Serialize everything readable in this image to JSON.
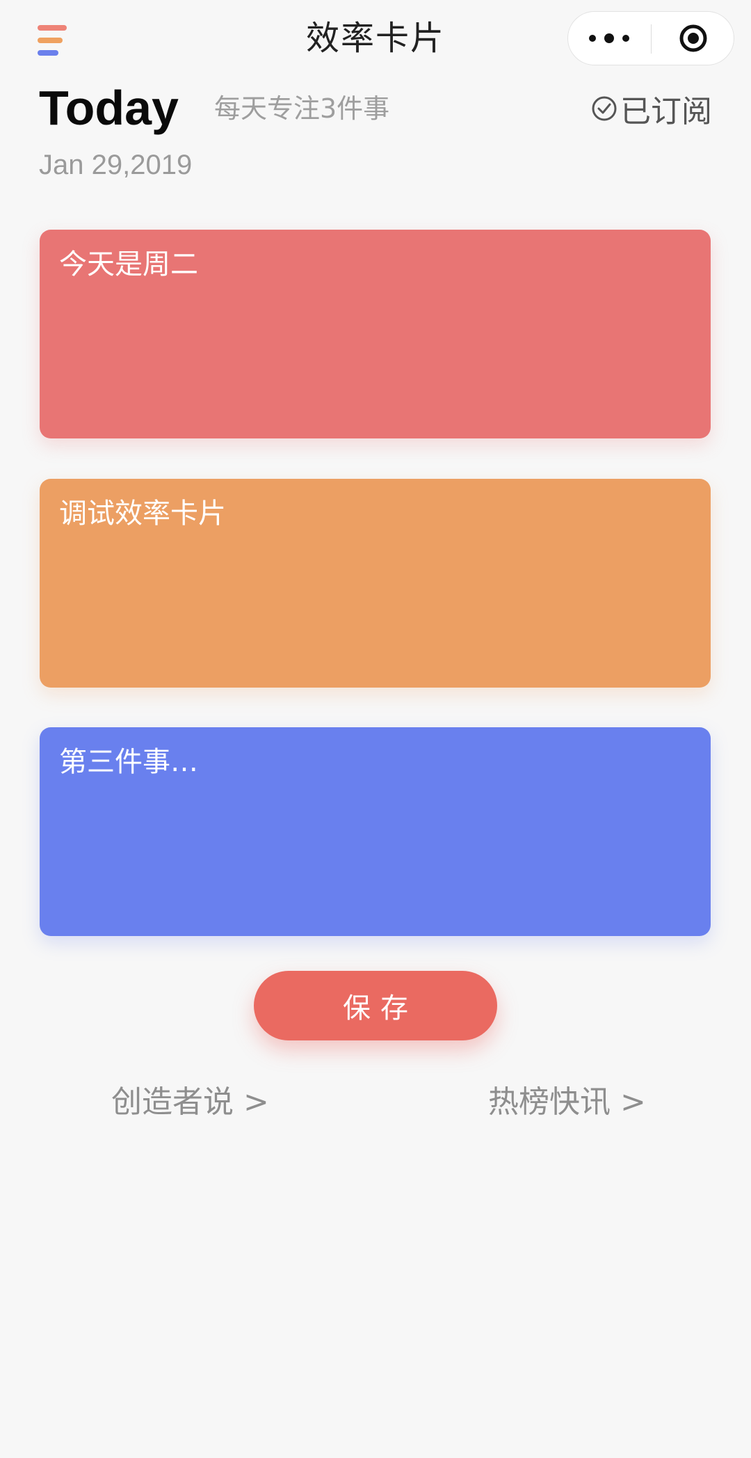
{
  "nav": {
    "title": "效率卡片",
    "menu_icon": "hamburger-menu-icon",
    "more_icon": "more-dots-icon",
    "close_icon": "target-circle-icon",
    "menu_colors": [
      "#ee8377",
      "#efa160",
      "#6b80ec"
    ]
  },
  "header": {
    "today": "Today",
    "slogan": "每天专注3件事",
    "subscribe_label": "已订阅",
    "subscribe_icon": "check-circle-icon",
    "date": "Jan 29,2019"
  },
  "cards": [
    {
      "value": "今天是周二",
      "placeholder": "",
      "color": "#e87574"
    },
    {
      "value": "调试效率卡片",
      "placeholder": "",
      "color": "#ec9f63"
    },
    {
      "value": "",
      "placeholder": "第三件事…",
      "color": "#6980ee"
    }
  ],
  "save_button": {
    "label": "保存",
    "color": "#ea6a61"
  },
  "links": {
    "creator": "创造者说 >",
    "hot": "热榜快讯 >"
  }
}
